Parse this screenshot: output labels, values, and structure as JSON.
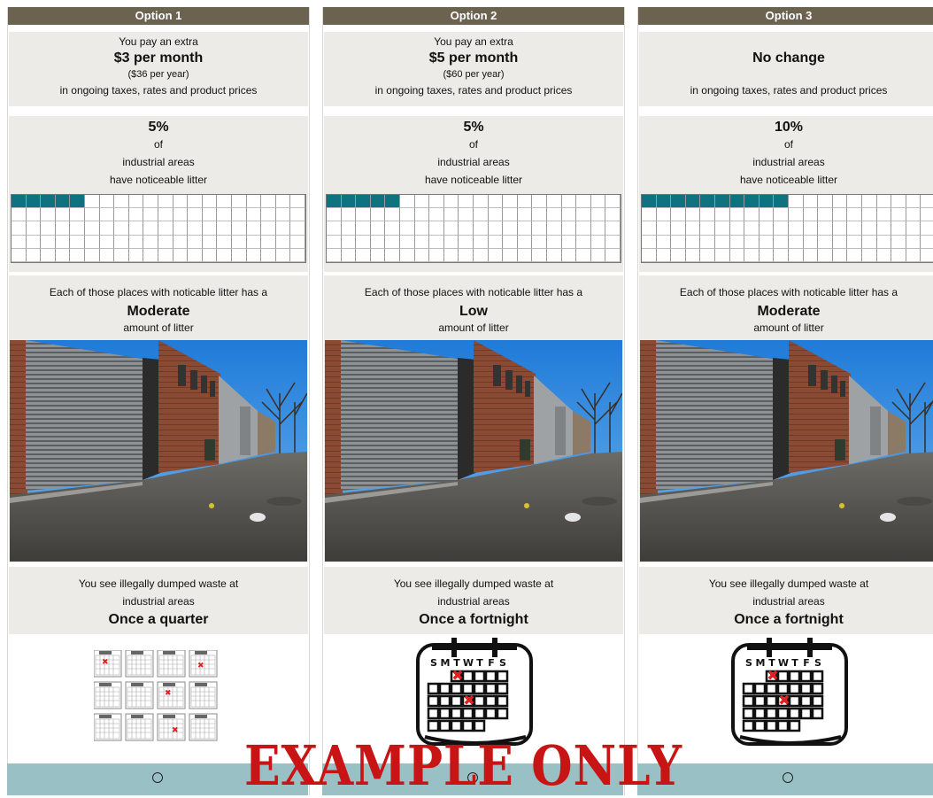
{
  "options": [
    {
      "title": "Option 1",
      "cost": {
        "pre": "You pay an extra",
        "amount": "$3 per month",
        "yearly": "($36 per year)",
        "post": "in ongoing taxes, rates and product prices"
      },
      "percent": {
        "value": "5%",
        "of": "of",
        "area": "industrial areas",
        "desc": "have noticeable litter",
        "fraction": 0.05
      },
      "litter": {
        "pre": "Each of those places with noticable litter has a",
        "level": "Moderate",
        "post": "amount of litter"
      },
      "dump": {
        "pre": "You see illegally dumped waste at",
        "area": "industrial areas",
        "freq": "Once a quarter",
        "icon": "twelve-calendars-icon"
      }
    },
    {
      "title": "Option 2",
      "cost": {
        "pre": "You pay an extra",
        "amount": "$5 per month",
        "yearly": "($60 per year)",
        "post": "in ongoing taxes, rates and product prices"
      },
      "percent": {
        "value": "5%",
        "of": "of",
        "area": "industrial areas",
        "desc": "have noticeable litter",
        "fraction": 0.05
      },
      "litter": {
        "pre": "Each of those places with noticable litter has a",
        "level": "Low",
        "post": "amount of litter"
      },
      "dump": {
        "pre": "You see illegally dumped waste at",
        "area": "industrial areas",
        "freq": "Once a fortnight",
        "icon": "calendar-icon",
        "weekdays": [
          "S",
          "M",
          "T",
          "W",
          "T",
          "F",
          "S"
        ]
      }
    },
    {
      "title": "Option 3",
      "cost": {
        "pre": "",
        "amount": "No change",
        "yearly": "",
        "post": "in ongoing taxes, rates and product prices"
      },
      "percent": {
        "value": "10%",
        "of": "of",
        "area": "industrial areas",
        "desc": "have noticeable litter",
        "fraction": 0.1
      },
      "litter": {
        "pre": "Each of those places with noticable litter has a",
        "level": "Moderate",
        "post": "amount of litter"
      },
      "dump": {
        "pre": "You see illegally dumped waste at",
        "area": "industrial areas",
        "freq": "Once a fortnight",
        "icon": "calendar-icon",
        "weekdays": [
          "S",
          "M",
          "T",
          "W",
          "T",
          "F",
          "S"
        ]
      }
    }
  ],
  "watermark": "EXAMPLE ONLY",
  "colors": {
    "header": "#6b6250",
    "panel": "#ecebe7",
    "grid_fill": "#0e7280",
    "footer": "#99c1c5",
    "stamp": "#c81414"
  }
}
